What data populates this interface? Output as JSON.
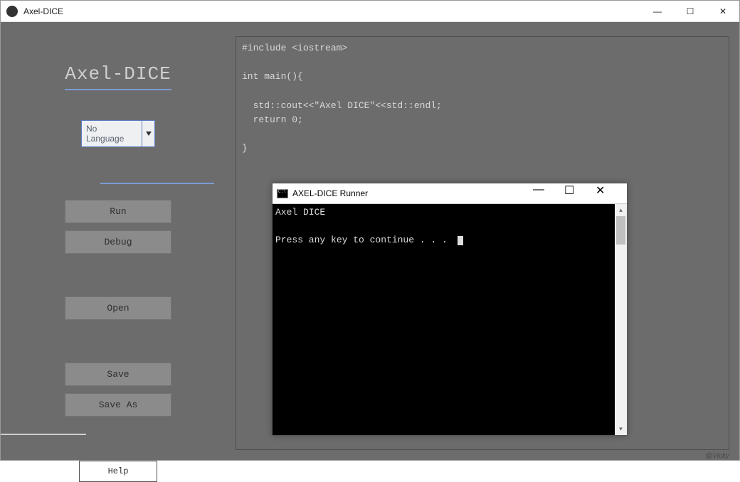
{
  "window": {
    "title": "Axel-DICE",
    "controls": {
      "minimize": "—",
      "maximize": "☐",
      "close": "✕"
    }
  },
  "sidebar": {
    "title": "Axel-DICE",
    "language_select": "No Language",
    "buttons": {
      "run": "Run",
      "debug": "Debug",
      "open": "Open",
      "save": "Save",
      "save_as": "Save As",
      "help": "Help"
    }
  },
  "editor": {
    "code": "#include <iostream>\n\nint main(){\n\n  std::cout<<\"Axel DICE\"<<std::endl;\n  return 0;\n\n}"
  },
  "runner": {
    "title": "AXEL-DICE Runner",
    "output": "Axel DICE\n\nPress any key to continue . . .",
    "controls": {
      "minimize": "—",
      "maximize": "☐",
      "close": "✕"
    }
  },
  "credit": "@Vicky"
}
